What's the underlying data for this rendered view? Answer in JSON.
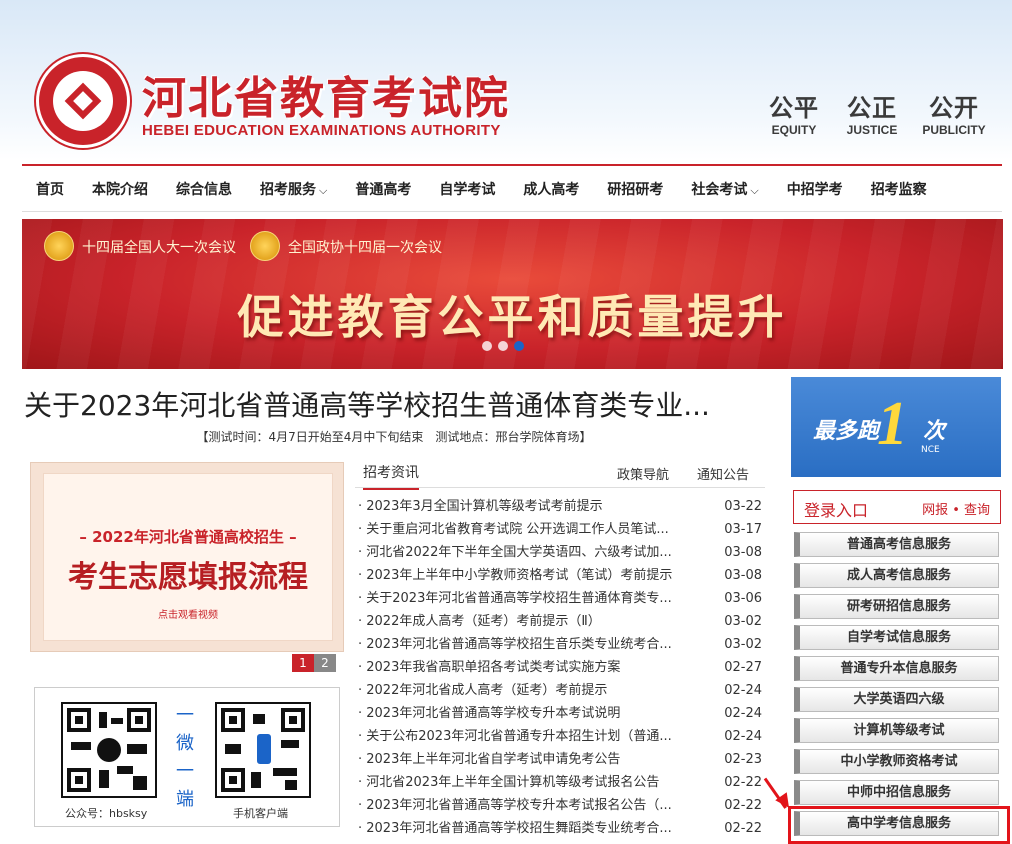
{
  "header": {
    "title": "河北省教育考试院",
    "subtitle": "HEBEI EDUCATION EXAMINATIONS AUTHORITY",
    "mottos": [
      {
        "cn": "公平",
        "en": "EQUITY"
      },
      {
        "cn": "公正",
        "en": "JUSTICE"
      },
      {
        "cn": "公开",
        "en": "PUBLICITY"
      }
    ]
  },
  "nav": {
    "items": [
      {
        "label": "首页"
      },
      {
        "label": "本院介绍"
      },
      {
        "label": "综合信息"
      },
      {
        "label": "招考服务",
        "chevron": "⌵"
      },
      {
        "label": "普通高考"
      },
      {
        "label": "自学考试"
      },
      {
        "label": "成人高考"
      },
      {
        "label": "研招研考"
      },
      {
        "label": "社会考试",
        "chevron": "⌵"
      },
      {
        "label": "中招学考"
      },
      {
        "label": "招考监察"
      }
    ]
  },
  "banner": {
    "meeting1": "十四届全国人大一次会议",
    "meeting2": "全国政协十四届一次会议",
    "slogan": "促进教育公平和质量提升",
    "slide_count": 3,
    "active_slide": 3
  },
  "headline": {
    "title": "关于2023年河北省普通高等学校招生普通体育类专业...",
    "sub": "【测试时间：4月7日开始至4月中下旬结束　测试地点：邢台学院体育场】"
  },
  "feature": {
    "line1": "– 2022年河北省普通高校招生 –",
    "line2": "考生志愿填报流程",
    "line3": "点击观看视频",
    "pages": [
      "1",
      "2"
    ],
    "active_page": "1"
  },
  "qr": {
    "label_left": "公众号：hbsksy",
    "label_right": "手机客户端",
    "middle_chars": [
      "一",
      "微",
      "一",
      "端"
    ]
  },
  "news": {
    "tab_main": "招考资讯",
    "tab2": "政策导航",
    "tab3": "通知公告",
    "items": [
      {
        "title": "· 2023年3月全国计算机等级考试考前提示",
        "date": "03-22"
      },
      {
        "title": "· 关于重启河北省教育考试院 公开选调工作人员笔试...",
        "date": "03-17"
      },
      {
        "title": "· 河北省2022年下半年全国大学英语四、六级考试加...",
        "date": "03-08"
      },
      {
        "title": "· 2023年上半年中小学教师资格考试（笔试）考前提示",
        "date": "03-08"
      },
      {
        "title": "· 关于2023年河北省普通高等学校招生普通体育类专...",
        "date": "03-06"
      },
      {
        "title": "· 2022年成人高考（延考）考前提示（Ⅱ）",
        "date": "03-02"
      },
      {
        "title": "· 2023年河北省普通高等学校招生音乐类专业统考合...",
        "date": "03-02"
      },
      {
        "title": "· 2023年我省高职单招各考试类考试实施方案",
        "date": "02-27"
      },
      {
        "title": "· 2022年河北省成人高考（延考）考前提示",
        "date": "02-24"
      },
      {
        "title": "· 2023年河北省普通高等学校专升本考试说明",
        "date": "02-24"
      },
      {
        "title": "· 关于公布2023年河北省普通专升本招生计划（普通...",
        "date": "02-24"
      },
      {
        "title": "· 2023年上半年河北省自学考试申请免考公告",
        "date": "02-23"
      },
      {
        "title": "· 河北省2023年上半年全国计算机等级考试报名公告",
        "date": "02-22"
      },
      {
        "title": "· 2023年河北省普通高等学校专升本考试报名公告（...",
        "date": "02-22"
      },
      {
        "title": "· 2023年河北省普通高等学校招生舞蹈类专业统考合...",
        "date": "02-22"
      }
    ]
  },
  "sidebar": {
    "promo_text1": "最多跑",
    "promo_one": "1",
    "promo_text2": "次",
    "promo_once": "NCE",
    "login_title": "登录入口",
    "login_links": "网报 • 查询",
    "services": [
      "普通高考信息服务",
      "成人高考信息服务",
      "研考研招信息服务",
      "自学考试信息服务",
      "普通专升本信息服务",
      "大学英语四六级",
      "计算机等级考试",
      "中小学教师资格考试",
      "中师中招信息服务",
      "高中学考信息服务"
    ]
  },
  "colors": {
    "brand_red": "#c9232a",
    "highlight_red": "#e2141a",
    "link_blue": "#1b64c8"
  }
}
